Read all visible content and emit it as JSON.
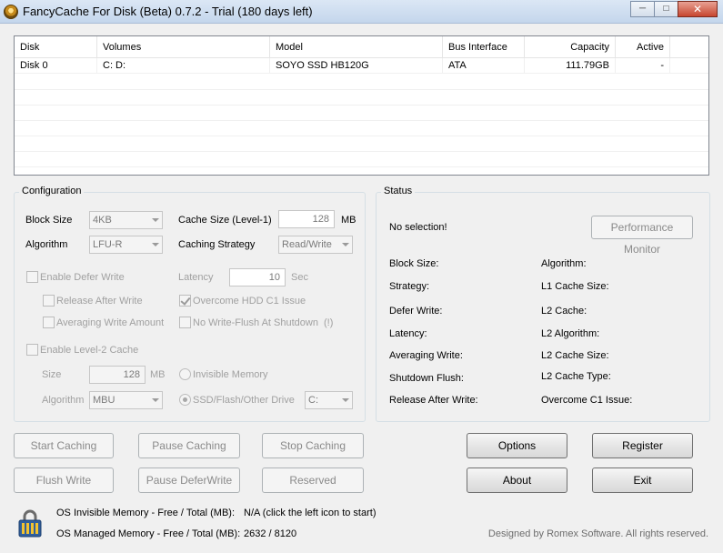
{
  "window": {
    "title": "FancyCache For Disk (Beta) 0.7.2 - Trial (180 days left)"
  },
  "table": {
    "headers": [
      "Disk",
      "Volumes",
      "Model",
      "Bus Interface",
      "Capacity",
      "Active"
    ],
    "rows": [
      {
        "disk": "Disk 0",
        "volumes": "C: D:",
        "model": "SOYO SSD HB120G",
        "bus": "ATA",
        "capacity": "111.79GB",
        "active": "-"
      }
    ]
  },
  "config": {
    "title": "Configuration",
    "block_size_label": "Block Size",
    "block_size_value": "4KB",
    "cache_size_label": "Cache Size (Level-1)",
    "cache_size_value": "128",
    "cache_size_unit": "MB",
    "algorithm_label": "Algorithm",
    "algorithm_value": "LFU-R",
    "caching_strategy_label": "Caching Strategy",
    "caching_strategy_value": "Read/Write",
    "enable_defer_write": "Enable Defer Write",
    "latency_label": "Latency",
    "latency_value": "10",
    "latency_unit": "Sec",
    "release_after_write": "Release After Write",
    "overcome_hdd": "Overcome HDD C1 Issue",
    "averaging_write": "Averaging Write Amount",
    "no_write_flush": "No Write-Flush At Shutdown",
    "no_write_flush_hint": "(!)",
    "enable_l2": "Enable Level-2 Cache",
    "l2_size_label": "Size",
    "l2_size_value": "128",
    "l2_size_unit": "MB",
    "invisible_memory": "Invisible Memory",
    "l2_algorithm_label": "Algorithm",
    "l2_algorithm_value": "MBU",
    "ssd_drive": "SSD/Flash/Other Drive",
    "drive_value": "C:"
  },
  "status": {
    "title": "Status",
    "selection": "No selection!",
    "perf_monitor": "Performance Monitor",
    "left": [
      "Block Size:",
      "Strategy:",
      "Defer Write:",
      "Latency:",
      "Averaging Write:",
      "Shutdown Flush:",
      "Release After Write:"
    ],
    "right": [
      "Algorithm:",
      "L1 Cache Size:",
      "L2 Cache:",
      "L2 Algorithm:",
      "L2 Cache Size:",
      "L2 Cache Type:",
      "Overcome C1 Issue:"
    ]
  },
  "buttons": {
    "start_caching": "Start Caching",
    "pause_caching": "Pause Caching",
    "stop_caching": "Stop Caching",
    "flush_write": "Flush Write",
    "pause_defer": "Pause DeferWrite",
    "reserved": "Reserved",
    "options": "Options",
    "register": "Register",
    "about": "About",
    "exit": "Exit"
  },
  "footer": {
    "os_invisible_label": "OS Invisible Memory - Free / Total (MB):",
    "os_invisible_value": "N/A (click the left icon to start)",
    "os_managed_label": "OS Managed Memory - Free / Total (MB):",
    "os_managed_value": "2632 / 8120",
    "credit": "Designed by Romex Software. All rights reserved."
  },
  "icons": [
    "app-icon",
    "minimize-icon",
    "maximize-icon",
    "close-icon",
    "lock-memory-icon"
  ]
}
